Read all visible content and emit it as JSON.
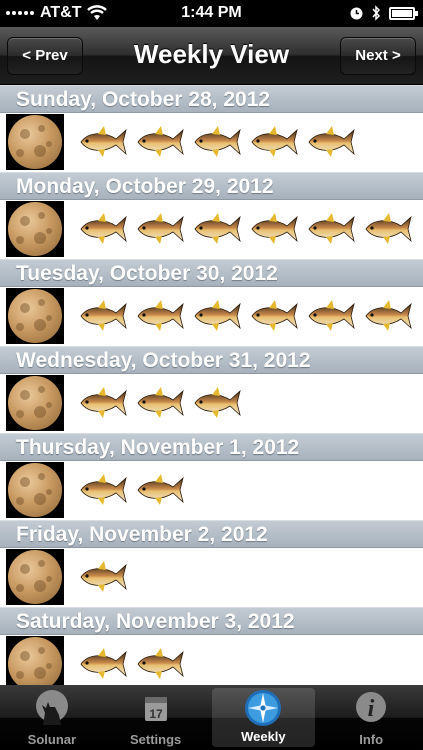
{
  "status_bar": {
    "carrier": "AT&T",
    "time": "1:44 PM",
    "battery_level": 0.9
  },
  "nav": {
    "title": "Weekly View",
    "prev_label": "< Prev",
    "next_label": "Next >"
  },
  "days": [
    {
      "label": "Sunday, October 28, 2012",
      "fish_count": 5
    },
    {
      "label": "Monday, October 29, 2012",
      "fish_count": 6
    },
    {
      "label": "Tuesday, October 30, 2012",
      "fish_count": 6
    },
    {
      "label": "Wednesday, October 31, 2012",
      "fish_count": 3
    },
    {
      "label": "Thursday, November 1, 2012",
      "fish_count": 2
    },
    {
      "label": "Friday, November 2, 2012",
      "fish_count": 1
    },
    {
      "label": "Saturday, November 3, 2012",
      "fish_count": 2
    }
  ],
  "tabs": [
    {
      "label": "Solunar",
      "icon": "wolf-moon-icon",
      "active": false
    },
    {
      "label": "Settings",
      "icon": "calendar-icon",
      "active": false,
      "icon_text": "17"
    },
    {
      "label": "Weekly",
      "icon": "compass-icon",
      "active": true
    },
    {
      "label": "Info",
      "icon": "info-icon",
      "active": false,
      "icon_text": "i"
    }
  ],
  "colors": {
    "header_bg": "#a7b2bd",
    "moon": "#c99a62",
    "active_tab_icon": "#2f8fd8"
  }
}
